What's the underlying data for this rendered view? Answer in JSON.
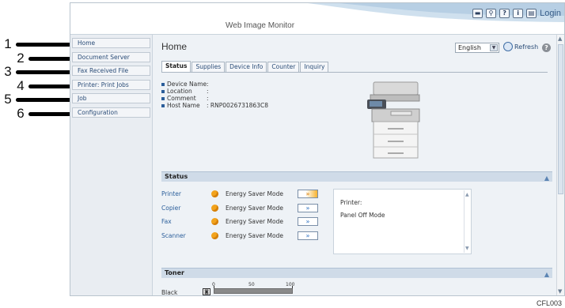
{
  "callouts": [
    "1",
    "2",
    "3",
    "4",
    "5",
    "6"
  ],
  "header": {
    "title": "Web Image Monitor",
    "login_label": "Login",
    "icons": [
      "keyboard-icon",
      "search-icon",
      "help-icon",
      "info-icon",
      "login-icon"
    ]
  },
  "sidebar": {
    "items": [
      {
        "label": "Home"
      },
      {
        "label": "Document Server"
      },
      {
        "label": "Fax Received File"
      },
      {
        "label": "Printer: Print Jobs"
      },
      {
        "label": "Job"
      },
      {
        "label": "Configuration"
      }
    ]
  },
  "main": {
    "title": "Home",
    "language": "English",
    "refresh_label": "Refresh",
    "tabs": [
      {
        "label": "Status",
        "active": true
      },
      {
        "label": "Supplies",
        "active": false
      },
      {
        "label": "Device Info",
        "active": false
      },
      {
        "label": "Counter",
        "active": false
      },
      {
        "label": "Inquiry",
        "active": false
      }
    ],
    "device_info": [
      {
        "label": "Device Name",
        "value": ":"
      },
      {
        "label": "Location",
        "value": ":"
      },
      {
        "label": "Comment",
        "value": ":"
      },
      {
        "label": "Host Name",
        "value": ": RNP0026731863C8"
      }
    ],
    "status_section": {
      "title": "Status",
      "rows": [
        {
          "device": "Printer",
          "mode": "Energy Saver Mode",
          "highlight": true
        },
        {
          "device": "Copier",
          "mode": "Energy Saver Mode",
          "highlight": false
        },
        {
          "device": "Fax",
          "mode": "Energy Saver Mode",
          "highlight": false
        },
        {
          "device": "Scanner",
          "mode": "Energy Saver Mode",
          "highlight": false
        }
      ],
      "message_line1": "Printer:",
      "message_line2": "Panel Off Mode"
    },
    "toner_section": {
      "title": "Toner",
      "scale": [
        "0",
        "50",
        "100"
      ],
      "color_label": "Black",
      "level_percent": 100
    }
  },
  "figure_id": "CFL003",
  "colors": {
    "accent": "#2b4d78",
    "status_dot": "#f2a31c",
    "header_band": "#cfdbe8"
  }
}
